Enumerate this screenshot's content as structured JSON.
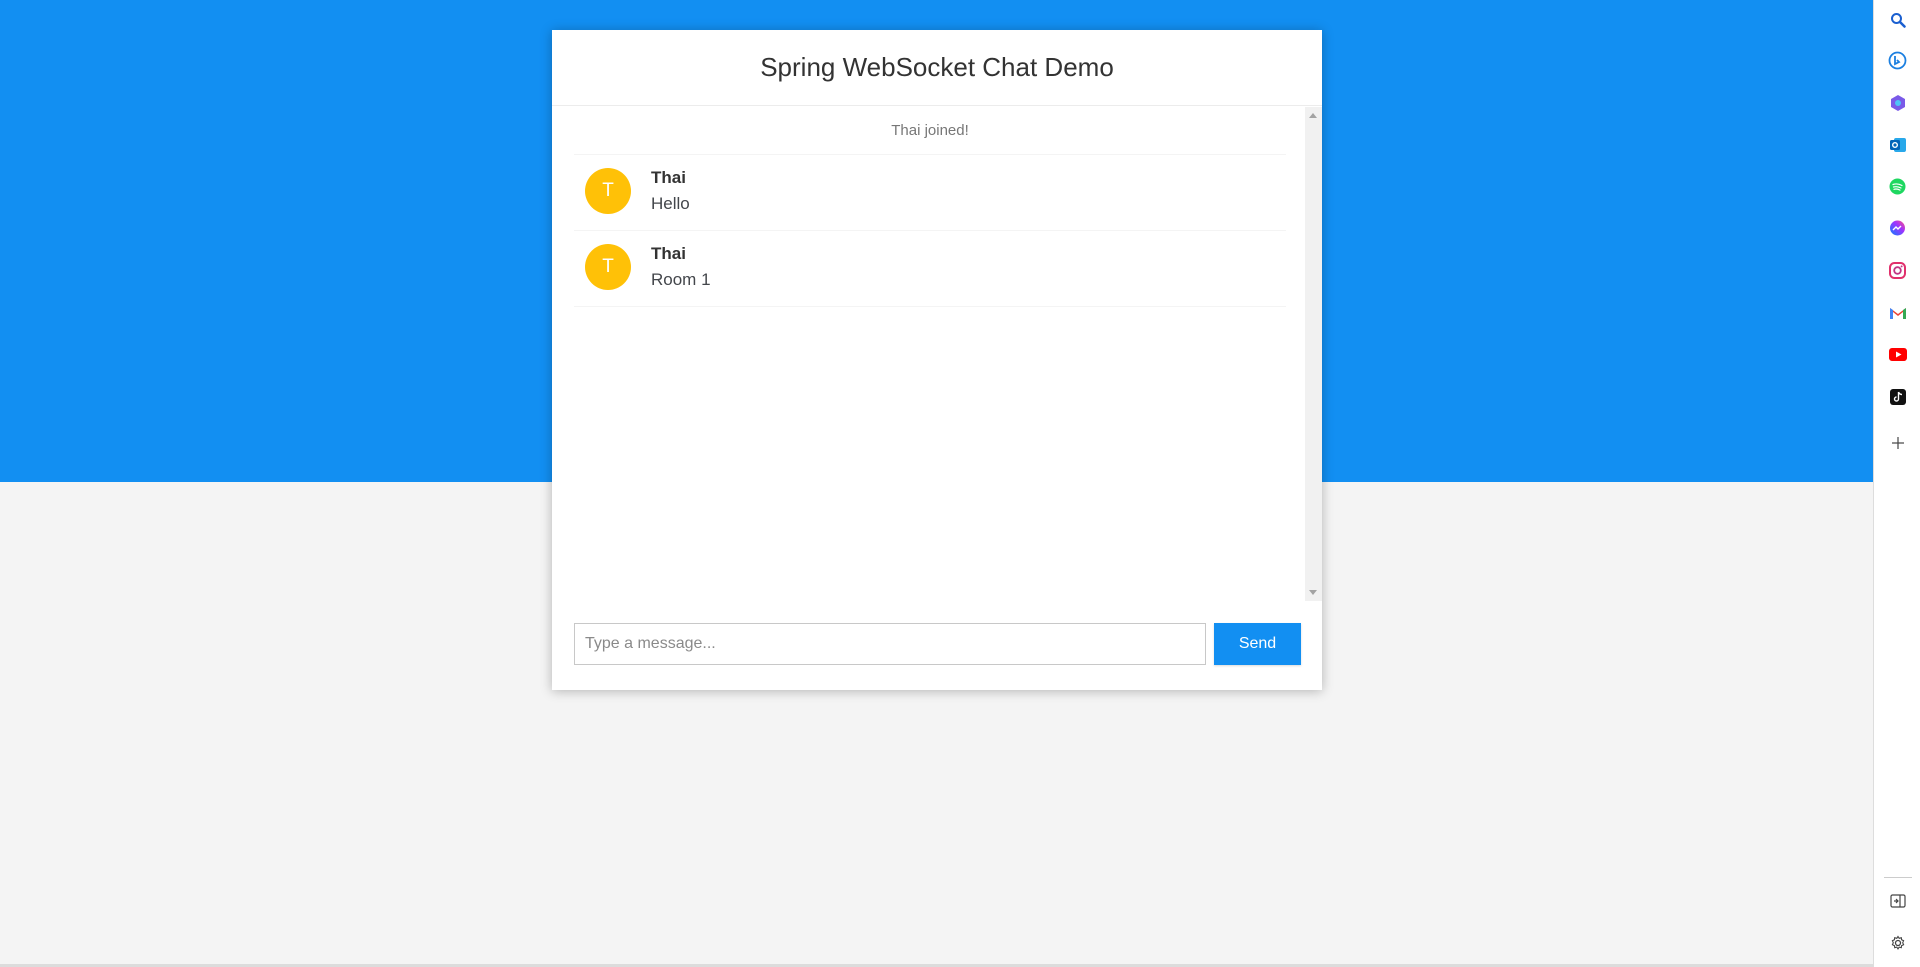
{
  "chat": {
    "title": "Spring WebSocket Chat Demo",
    "events": [
      {
        "text": "Thai joined!"
      }
    ],
    "messages": [
      {
        "avatar_letter": "T",
        "avatar_color": "#ffc107",
        "sender": "Thai",
        "text": "Hello"
      },
      {
        "avatar_letter": "T",
        "avatar_color": "#ffc107",
        "sender": "Thai",
        "text": "Room 1"
      }
    ],
    "input": {
      "placeholder": "Type a message...",
      "value": ""
    },
    "send_label": "Send"
  },
  "colors": {
    "primary": "#128ff2",
    "avatar": "#ffc107",
    "background": "#f4f4f4"
  },
  "sidebar": {
    "icons": [
      "search-icon",
      "bing-icon",
      "copilot-icon",
      "outlook-icon",
      "spotify-icon",
      "messenger-icon",
      "instagram-icon",
      "gmail-icon",
      "youtube-icon",
      "tiktok-icon",
      "add-icon",
      "hide-sidebar-icon",
      "settings-icon"
    ]
  }
}
